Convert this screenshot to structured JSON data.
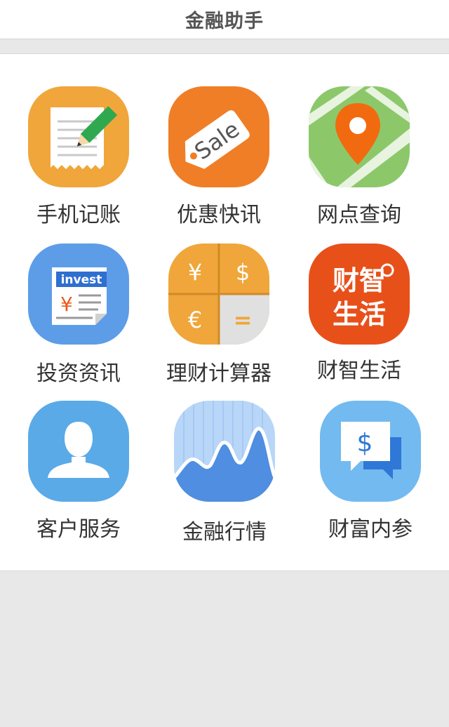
{
  "header": {
    "title": "金融助手"
  },
  "colors": {
    "background": "#e8e8e8",
    "panel": "#ffffff",
    "text": "#333333",
    "orange": "#f07e26",
    "amber": "#f0a63a",
    "green": "#8cc86a",
    "blue": "#5d9de8",
    "light_blue": "#73baf0",
    "red_orange": "#e8501a"
  },
  "tiles": [
    {
      "label": "手机记账",
      "icon": "notepad-pencil-icon"
    },
    {
      "label": "优惠快讯",
      "icon": "sale-tag-icon"
    },
    {
      "label": "网点查询",
      "icon": "map-pin-icon"
    },
    {
      "label": "投资资讯",
      "icon": "newspaper-icon"
    },
    {
      "label": "理财计算器",
      "icon": "currency-calculator-icon"
    },
    {
      "label": "财智生活",
      "icon": "caizhi-shenghuo-icon"
    },
    {
      "label": "客户服务",
      "icon": "person-icon"
    },
    {
      "label": "金融行情",
      "icon": "market-chart-icon"
    },
    {
      "label": "财富内参",
      "icon": "chat-dollar-icon"
    }
  ],
  "icon_text": {
    "sale": "Sale",
    "invest": "invest",
    "yuan": "¥",
    "dollar": "$",
    "euro": "€",
    "equals": "=",
    "caizhi_line1": "财智",
    "caizhi_line2": "生活"
  }
}
